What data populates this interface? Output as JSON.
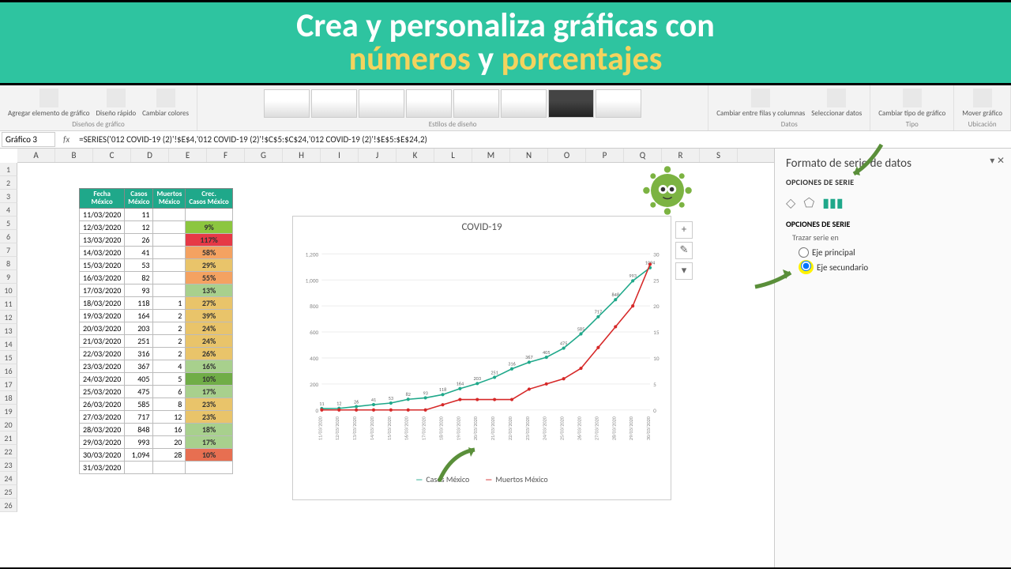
{
  "banner": {
    "line1": "Crea y personaliza gráficas con",
    "word1": "números",
    "word2": "y",
    "word3": "porcentajes"
  },
  "ribbon": {
    "add_element": "Agregar elemento de gráfico",
    "quick_layout": "Diseño rápido",
    "change_colors": "Cambiar colores",
    "group_designs": "Diseños de gráfico",
    "group_styles": "Estilos de diseño",
    "switch": "Cambiar entre filas y columnas",
    "select_data": "Seleccionar datos",
    "group_data": "Datos",
    "change_type": "Cambiar tipo de gráfico",
    "group_type": "Tipo",
    "move": "Mover gráfico",
    "group_location": "Ubicación"
  },
  "formula": {
    "name": "Gráfico 3",
    "fx": "fx",
    "text": "=SERIES('012 COVID-19 (2)'!$E$4,'012 COVID-19 (2)'!$C$5:$C$24,'012 COVID-19 (2)'!$E$5:$E$24,2)"
  },
  "cols": [
    "A",
    "B",
    "C",
    "D",
    "E",
    "F",
    "G",
    "H",
    "I",
    "J",
    "K",
    "L",
    "M",
    "N",
    "O",
    "P",
    "Q",
    "R",
    "S"
  ],
  "rowcount": 26,
  "table": {
    "headers": [
      "Fecha México",
      "Casos México",
      "Muertos México",
      "Crec. Casos México"
    ],
    "rows": [
      {
        "date": "11/03/2020",
        "cases": "11",
        "deaths": "",
        "growth": "",
        "color": ""
      },
      {
        "date": "12/03/2020",
        "cases": "12",
        "deaths": "",
        "growth": "9%",
        "color": "#8cc63f"
      },
      {
        "date": "13/03/2020",
        "cases": "26",
        "deaths": "",
        "growth": "117%",
        "color": "#e63946"
      },
      {
        "date": "14/03/2020",
        "cases": "41",
        "deaths": "",
        "growth": "58%",
        "color": "#f4a261"
      },
      {
        "date": "15/03/2020",
        "cases": "53",
        "deaths": "",
        "growth": "29%",
        "color": "#e9c46a"
      },
      {
        "date": "16/03/2020",
        "cases": "82",
        "deaths": "",
        "growth": "55%",
        "color": "#f4a261"
      },
      {
        "date": "17/03/2020",
        "cases": "93",
        "deaths": "",
        "growth": "13%",
        "color": "#a8d08d"
      },
      {
        "date": "18/03/2020",
        "cases": "118",
        "deaths": "1",
        "growth": "27%",
        "color": "#e9c46a"
      },
      {
        "date": "19/03/2020",
        "cases": "164",
        "deaths": "2",
        "growth": "39%",
        "color": "#e9c46a"
      },
      {
        "date": "20/03/2020",
        "cases": "203",
        "deaths": "2",
        "growth": "24%",
        "color": "#e9c46a"
      },
      {
        "date": "21/03/2020",
        "cases": "251",
        "deaths": "2",
        "growth": "24%",
        "color": "#e9c46a"
      },
      {
        "date": "22/03/2020",
        "cases": "316",
        "deaths": "2",
        "growth": "26%",
        "color": "#e9c46a"
      },
      {
        "date": "23/03/2020",
        "cases": "367",
        "deaths": "4",
        "growth": "16%",
        "color": "#a8d08d"
      },
      {
        "date": "24/03/2020",
        "cases": "405",
        "deaths": "5",
        "growth": "10%",
        "color": "#70ad47"
      },
      {
        "date": "25/03/2020",
        "cases": "475",
        "deaths": "6",
        "growth": "17%",
        "color": "#a8d08d"
      },
      {
        "date": "26/03/2020",
        "cases": "585",
        "deaths": "8",
        "growth": "23%",
        "color": "#e9c46a"
      },
      {
        "date": "27/03/2020",
        "cases": "717",
        "deaths": "12",
        "growth": "23%",
        "color": "#e9c46a"
      },
      {
        "date": "28/03/2020",
        "cases": "848",
        "deaths": "16",
        "growth": "18%",
        "color": "#a8d08d"
      },
      {
        "date": "29/03/2020",
        "cases": "993",
        "deaths": "20",
        "growth": "17%",
        "color": "#a8d08d"
      },
      {
        "date": "30/03/2020",
        "cases": "1,094",
        "deaths": "28",
        "growth": "10%",
        "color": "#e76f51"
      },
      {
        "date": "31/03/2020",
        "cases": "",
        "deaths": "",
        "growth": "",
        "color": ""
      }
    ]
  },
  "chart_data": {
    "type": "line",
    "title": "COVID-19",
    "categories": [
      "11/03/2020",
      "12/03/2020",
      "13/03/2020",
      "14/03/2020",
      "15/03/2020",
      "16/03/2020",
      "17/03/2020",
      "18/03/2020",
      "19/03/2020",
      "20/03/2020",
      "21/03/2020",
      "22/03/2020",
      "23/03/2020",
      "24/03/2020",
      "25/03/2020",
      "26/03/2020",
      "27/03/2020",
      "28/03/2020",
      "29/03/2020",
      "30/03/2020"
    ],
    "series": [
      {
        "name": "Casos México",
        "color": "#1fa88a",
        "axis": "primary",
        "values": [
          11,
          12,
          26,
          41,
          53,
          82,
          93,
          118,
          164,
          203,
          251,
          316,
          367,
          405,
          475,
          585,
          717,
          848,
          993,
          1094
        ]
      },
      {
        "name": "Muertos México",
        "color": "#d62828",
        "axis": "secondary",
        "values": [
          0,
          0,
          0,
          0,
          0,
          0,
          0,
          1,
          2,
          2,
          2,
          2,
          4,
          5,
          6,
          8,
          12,
          16,
          20,
          28
        ]
      }
    ],
    "y1_ticks": [
      0,
      200,
      400,
      600,
      800,
      1000,
      1200
    ],
    "y2_ticks": [
      0,
      5,
      10,
      15,
      20,
      25,
      30
    ],
    "legend": [
      "Casos México",
      "Muertos México"
    ]
  },
  "pane": {
    "title": "Formato de serie de datos",
    "subtitle": "OPCIONES DE SERIE",
    "section": "OPCIONES DE SERIE",
    "trace": "Trazar serie en",
    "opt1": "Eje principal",
    "opt2": "Eje secundario"
  },
  "chart_tools": {
    "plus": "+",
    "brush": "✎",
    "filter": "▾"
  }
}
